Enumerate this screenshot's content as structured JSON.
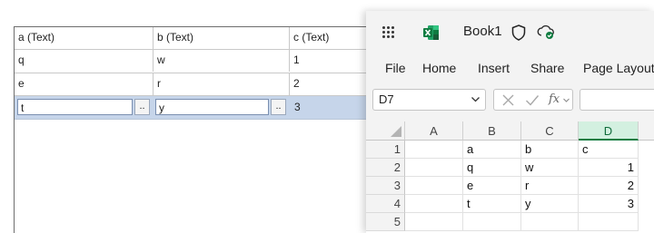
{
  "grid": {
    "headers": [
      "a (Text)",
      "b (Text)",
      "c (Text)"
    ],
    "rows": [
      [
        "q",
        "w",
        "1"
      ],
      [
        "e",
        "r",
        "2"
      ]
    ],
    "edit_row": [
      "t",
      "y",
      "3"
    ],
    "ellipsis": ".."
  },
  "excel": {
    "doc_title": "Book1",
    "menu": [
      "File",
      "Home",
      "Insert",
      "Share",
      "Page Layout"
    ],
    "name_box": "D7",
    "fx_label": "fx",
    "columns": [
      "A",
      "B",
      "C",
      "D"
    ],
    "selected_column": "D",
    "rows": [
      {
        "num": "1",
        "A": "",
        "B": "a",
        "C": "b",
        "D": "c"
      },
      {
        "num": "2",
        "A": "",
        "B": "q",
        "C": "w",
        "D": "1"
      },
      {
        "num": "3",
        "A": "",
        "B": "e",
        "C": "r",
        "D": "2"
      },
      {
        "num": "4",
        "A": "",
        "B": "t",
        "C": "y",
        "D": "3"
      },
      {
        "num": "5",
        "A": "",
        "B": "",
        "C": "",
        "D": ""
      }
    ],
    "icons": [
      "app-launcher-icon",
      "excel-logo-icon",
      "shield-icon",
      "cloud-saved-icon",
      "chevron-down-icon",
      "cancel-x-icon",
      "enter-check-icon",
      "fx-icon"
    ],
    "accent_color": "#107c41"
  }
}
